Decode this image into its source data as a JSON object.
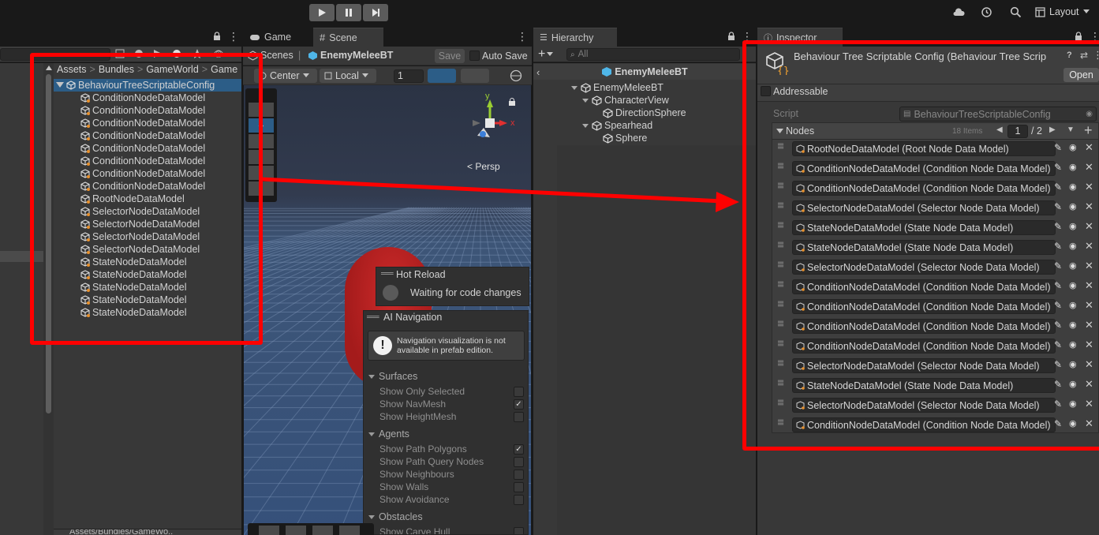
{
  "toolbar": {
    "layout_label": "Layout"
  },
  "tabs": {
    "game": "Game",
    "scene": "Scene",
    "hierarchy": "Hierarchy",
    "inspector": "Inspector"
  },
  "project": {
    "breadcrumb": [
      "Assets",
      "Bundles",
      "GameWorld",
      "Game"
    ],
    "root_item": "BehaviourTreeScriptableConfig",
    "items": [
      "ConditionNodeDataModel",
      "ConditionNodeDataModel",
      "ConditionNodeDataModel",
      "ConditionNodeDataModel",
      "ConditionNodeDataModel",
      "ConditionNodeDataModel",
      "ConditionNodeDataModel",
      "ConditionNodeDataModel",
      "RootNodeDataModel",
      "SelectorNodeDataModel",
      "SelectorNodeDataModel",
      "SelectorNodeDataModel",
      "SelectorNodeDataModel",
      "StateNodeDataModel",
      "StateNodeDataModel",
      "StateNodeDataModel",
      "StateNodeDataModel",
      "StateNodeDataModel"
    ],
    "footer_path": "Assets/Bundles/GameWo.."
  },
  "scene": {
    "breadcrumb_scenes": "Scenes",
    "breadcrumb_prefab": "EnemyMeleeBT",
    "save_label": "Save",
    "auto_save_label": "Auto Save",
    "pivot": "Center",
    "space": "Local",
    "grid_value": "1",
    "persp_label": "< Persp",
    "gizmo_y": "y",
    "gizmo_x": "x",
    "hot_reload": {
      "title": "Hot Reload",
      "status": "Waiting for code changes"
    },
    "ai_nav": {
      "title": "AI Navigation",
      "warning": "Navigation visualization is not available in prefab edition.",
      "surfaces_header": "Surfaces",
      "surfaces": [
        {
          "label": "Show Only Selected",
          "checked": false
        },
        {
          "label": "Show NavMesh",
          "checked": true
        },
        {
          "label": "Show HeightMesh",
          "checked": false
        }
      ],
      "agents_header": "Agents",
      "agents": [
        {
          "label": "Show Path Polygons",
          "checked": true
        },
        {
          "label": "Show Path Query Nodes",
          "checked": false
        },
        {
          "label": "Show Neighbours",
          "checked": false
        },
        {
          "label": "Show Walls",
          "checked": false
        },
        {
          "label": "Show Avoidance",
          "checked": false
        }
      ],
      "obstacles_header": "Obstacles",
      "obstacles": [
        {
          "label": "Show Carve Hull",
          "checked": false
        }
      ]
    }
  },
  "hierarchy": {
    "search_placeholder": "All",
    "root": "EnemyMeleeBT",
    "items": [
      {
        "label": "EnemyMeleeBT",
        "depth": 0,
        "expand": true
      },
      {
        "label": "CharacterView",
        "depth": 1,
        "expand": true
      },
      {
        "label": "DirectionSphere",
        "depth": 2,
        "expand": false
      },
      {
        "label": "Spearhead",
        "depth": 1,
        "expand": true
      },
      {
        "label": "Sphere",
        "depth": 2,
        "expand": false
      }
    ]
  },
  "inspector": {
    "title": "Behaviour Tree Scriptable Config (Behaviour Tree Scrip",
    "open_label": "Open",
    "addressable_label": "Addressable",
    "script_label": "Script",
    "script_value": "BehaviourTreeScriptableConfig",
    "nodes_label": "Nodes",
    "items_count": "18 Items",
    "page_current": "1",
    "page_total": "/ 2",
    "nodes": [
      "RootNodeDataModel (Root Node Data Model)",
      "ConditionNodeDataModel (Condition Node Data Model)",
      "ConditionNodeDataModel (Condition Node Data Model)",
      "SelectorNodeDataModel (Selector Node Data Model)",
      "StateNodeDataModel (State Node Data Model)",
      "StateNodeDataModel (State Node Data Model)",
      "SelectorNodeDataModel (Selector Node Data Model)",
      "ConditionNodeDataModel (Condition Node Data Model)",
      "ConditionNodeDataModel (Condition Node Data Model)",
      "ConditionNodeDataModel (Condition Node Data Model)",
      "ConditionNodeDataModel (Condition Node Data Model)",
      "SelectorNodeDataModel (Selector Node Data Model)",
      "StateNodeDataModel (State Node Data Model)",
      "SelectorNodeDataModel (Selector Node Data Model)",
      "ConditionNodeDataModel (Condition Node Data Model)"
    ]
  },
  "colors": {
    "annotation": "#ff0000",
    "selection": "#2c5d87",
    "panel": "#383838"
  }
}
